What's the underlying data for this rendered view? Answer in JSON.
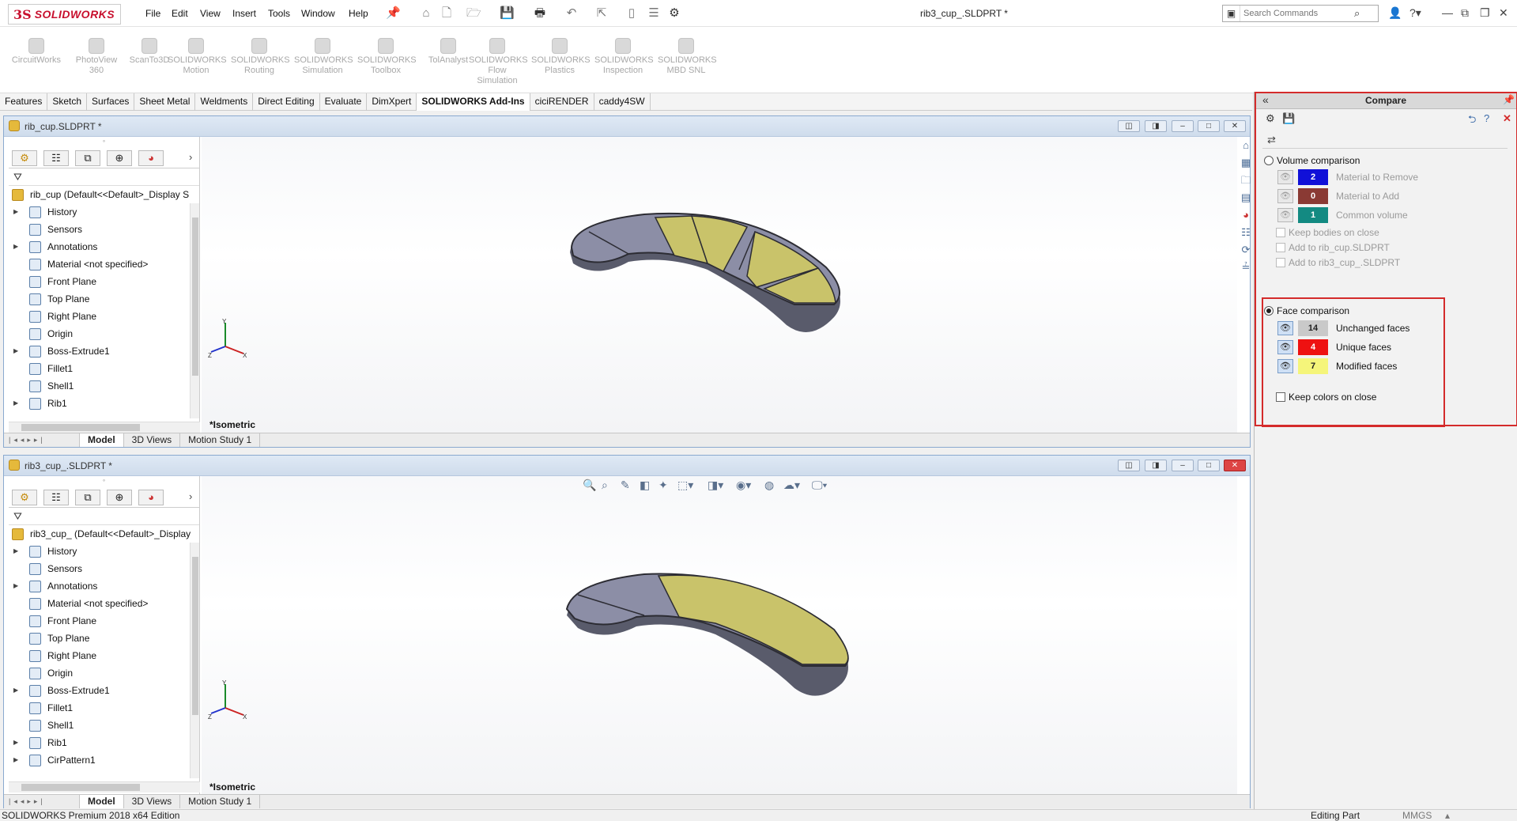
{
  "app": {
    "brand_ds": "3S",
    "brand_name": "SOLIDWORKS",
    "document_title": "rib3_cup_.SLDPRT *",
    "menu": [
      "File",
      "Edit",
      "View",
      "Insert",
      "Tools",
      "Window",
      "Help"
    ],
    "search_placeholder": "Search Commands"
  },
  "command_manager": {
    "items": [
      {
        "label1": "CircuitWorks",
        "label2": "",
        "label3": ""
      },
      {
        "label1": "PhotoView",
        "label2": "360",
        "label3": ""
      },
      {
        "label1": "ScanTo3D",
        "label2": "",
        "label3": ""
      },
      {
        "label1": "SOLIDWORKS",
        "label2": "Motion",
        "label3": ""
      },
      {
        "label1": "SOLIDWORKS",
        "label2": "Routing",
        "label3": ""
      },
      {
        "label1": "SOLIDWORKS",
        "label2": "Simulation",
        "label3": ""
      },
      {
        "label1": "SOLIDWORKS",
        "label2": "Toolbox",
        "label3": ""
      },
      {
        "label1": "TolAnalyst",
        "label2": "",
        "label3": ""
      },
      {
        "label1": "SOLIDWORKS",
        "label2": "Flow",
        "label3": "Simulation"
      },
      {
        "label1": "SOLIDWORKS",
        "label2": "Plastics",
        "label3": ""
      },
      {
        "label1": "SOLIDWORKS",
        "label2": "Inspection",
        "label3": ""
      },
      {
        "label1": "SOLIDWORKS",
        "label2": "MBD SNL",
        "label3": ""
      }
    ],
    "tabs": [
      "Features",
      "Sketch",
      "Surfaces",
      "Sheet Metal",
      "Weldments",
      "Direct Editing",
      "Evaluate",
      "DimXpert",
      "SOLIDWORKS Add-Ins",
      "ciciRENDER",
      "caddy4SW"
    ],
    "active_tab": "SOLIDWORKS Add-Ins"
  },
  "window1": {
    "title": "rib_cup.SLDPRT *",
    "tree_root": "rib_cup  (Default<<Default>_Display S",
    "tree": [
      {
        "label": "History",
        "expandable": true
      },
      {
        "label": "Sensors",
        "expandable": false
      },
      {
        "label": "Annotations",
        "expandable": true
      },
      {
        "label": "Material <not specified>",
        "expandable": false
      },
      {
        "label": "Front Plane",
        "expandable": false
      },
      {
        "label": "Top Plane",
        "expandable": false
      },
      {
        "label": "Right Plane",
        "expandable": false
      },
      {
        "label": "Origin",
        "expandable": false
      },
      {
        "label": "Boss-Extrude1",
        "expandable": true
      },
      {
        "label": "Fillet1",
        "expandable": false
      },
      {
        "label": "Shell1",
        "expandable": false
      },
      {
        "label": "Rib1",
        "expandable": true
      }
    ],
    "view_label": "*Isometric",
    "bottom_tabs": [
      "Model",
      "3D Views",
      "Motion Study 1"
    ]
  },
  "window2": {
    "title": "rib3_cup_.SLDPRT *",
    "tree_root": "rib3_cup_  (Default<<Default>_Display",
    "tree": [
      {
        "label": "History",
        "expandable": true
      },
      {
        "label": "Sensors",
        "expandable": false
      },
      {
        "label": "Annotations",
        "expandable": true
      },
      {
        "label": "Material <not specified>",
        "expandable": false
      },
      {
        "label": "Front Plane",
        "expandable": false
      },
      {
        "label": "Top Plane",
        "expandable": false
      },
      {
        "label": "Right Plane",
        "expandable": false
      },
      {
        "label": "Origin",
        "expandable": false
      },
      {
        "label": "Boss-Extrude1",
        "expandable": true
      },
      {
        "label": "Fillet1",
        "expandable": false
      },
      {
        "label": "Shell1",
        "expandable": false
      },
      {
        "label": "Rib1",
        "expandable": true
      },
      {
        "label": "CirPattern1",
        "expandable": true
      }
    ],
    "view_label": "*Isometric",
    "bottom_tabs": [
      "Model",
      "3D Views",
      "Motion Study 1"
    ]
  },
  "compare": {
    "title": "Compare",
    "volume": {
      "label": "Volume comparison",
      "selected": false,
      "rows": [
        {
          "count": "2",
          "label": "Material to Remove",
          "color": "#1010d8"
        },
        {
          "count": "0",
          "label": "Material to Add",
          "color": "#8a3a34"
        },
        {
          "count": "1",
          "label": "Common volume",
          "color": "#138a82"
        }
      ],
      "options": [
        "Keep bodies on close",
        "Add to rib_cup.SLDPRT",
        "Add to rib3_cup_.SLDPRT"
      ]
    },
    "face": {
      "label": "Face comparison",
      "selected": true,
      "rows": [
        {
          "count": "14",
          "label": "Unchanged faces",
          "color": "#c9c9c9"
        },
        {
          "count": "4",
          "label": "Unique faces",
          "color": "#ee1111"
        },
        {
          "count": "7",
          "label": "Modified faces",
          "color": "#f5f57a"
        }
      ],
      "keep_colors": "Keep colors on close"
    }
  },
  "status": {
    "edition": "SOLIDWORKS Premium 2018 x64 Edition",
    "mode": "Editing Part",
    "units": "MMGS"
  },
  "colors": {
    "unchanged": "#8c8ea6",
    "modified": "#c9c36a",
    "accent": "#d42b2b"
  }
}
